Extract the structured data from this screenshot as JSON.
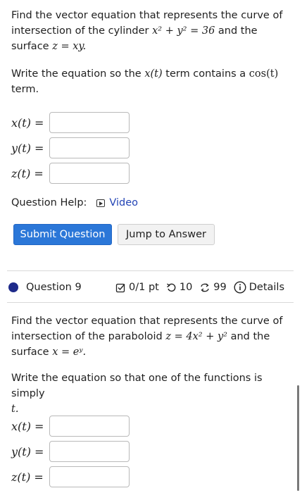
{
  "q8": {
    "prompt_line1": "Find the vector equation that represents the curve of",
    "prompt_line2_a": "intersection of the cylinder ",
    "prompt_line2_math": "x² + y² = 36",
    "prompt_line2_b": " and the",
    "prompt_line3_a": "surface ",
    "prompt_line3_math": "z = xy.",
    "instr_a": "Write the equation so the ",
    "instr_math1": "x(t)",
    "instr_b": " term contains a ",
    "instr_math2": "cos(t)",
    "instr_c": "term.",
    "fields": [
      {
        "label": "x(t)",
        "eq": " =",
        "value": ""
      },
      {
        "label": "y(t)",
        "eq": " =",
        "value": ""
      },
      {
        "label": "z(t)",
        "eq": " =",
        "value": ""
      }
    ],
    "help_label": "Question Help:",
    "video_label": "Video",
    "submit_label": "Submit Question",
    "jump_label": "Jump to Answer"
  },
  "q9": {
    "title": "Question 9",
    "points": "0/1 pt",
    "retries": "10",
    "attempts": "99",
    "details_label": "Details",
    "prompt_line1": "Find the vector equation that represents the curve of",
    "prompt_line2_a": "intersection of the paraboloid ",
    "prompt_line2_math": "z = 4x² + y²",
    "prompt_line2_b": " and the",
    "prompt_line3_a": "surface ",
    "prompt_line3_math": "x = eʸ.",
    "instr_line1": "Write the equation so that one of the functions is simply",
    "instr_line2_math": "t.",
    "fields": [
      {
        "label": "x(t)",
        "eq": " =",
        "value": ""
      },
      {
        "label": "y(t)",
        "eq": " =",
        "value": ""
      },
      {
        "label": "z(t)",
        "eq": " =",
        "value": ""
      }
    ]
  },
  "colors": {
    "submit_bg": "#2b77d8",
    "link": "#2344b5",
    "status_dot": "#1e2a8a"
  },
  "icons": {
    "video": "play-icon",
    "points": "checkbox-icon",
    "retries": "retry-icon",
    "attempts": "attempts-icon",
    "details": "info-icon"
  }
}
